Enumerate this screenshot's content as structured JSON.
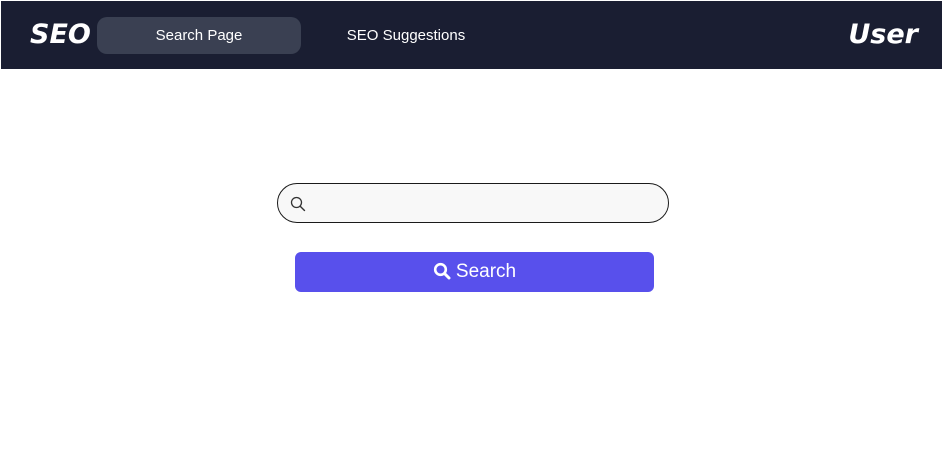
{
  "header": {
    "brand": "SEO",
    "nav": [
      {
        "label": "Search Page",
        "active": true
      },
      {
        "label": "SEO Suggestions",
        "active": false
      }
    ],
    "user": "User"
  },
  "search": {
    "value": "",
    "placeholder": "",
    "button_label": "Search",
    "input_icon": "search-icon",
    "button_icon": "search-icon"
  },
  "colors": {
    "navbar": "#1a1e32",
    "active_tab": "#3a4052",
    "button": "#5850ec"
  }
}
